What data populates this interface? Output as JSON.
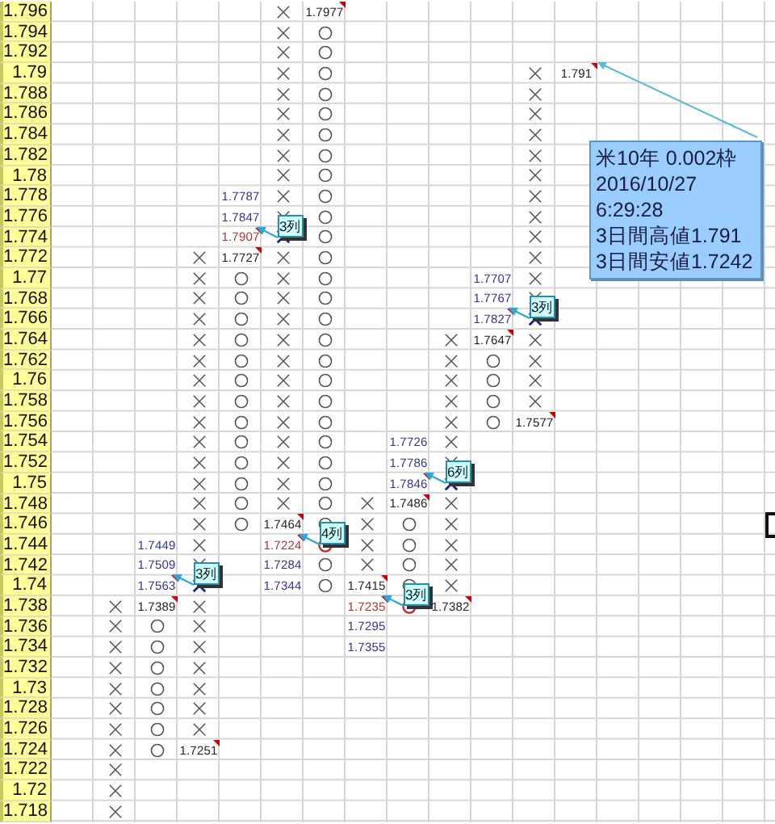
{
  "rows": [
    {
      "label": "1.796",
      "cells": [
        {
          "kind": "empty"
        },
        {
          "kind": "empty"
        },
        {
          "kind": "empty"
        },
        {
          "kind": "empty"
        },
        {
          "kind": "empty"
        },
        {
          "kind": "x",
          "highlight": false
        },
        {
          "kind": "text",
          "text": "1.7977",
          "color": "#222222",
          "comment": true
        }
      ]
    },
    {
      "label": "1.794",
      "cells": [
        {
          "kind": "empty"
        },
        {
          "kind": "empty"
        },
        {
          "kind": "empty"
        },
        {
          "kind": "empty"
        },
        {
          "kind": "empty"
        },
        {
          "kind": "x",
          "highlight": false
        },
        {
          "kind": "o",
          "highlight": false
        }
      ]
    },
    {
      "label": "1.792",
      "cells": [
        {
          "kind": "empty"
        },
        {
          "kind": "empty"
        },
        {
          "kind": "empty"
        },
        {
          "kind": "empty"
        },
        {
          "kind": "empty"
        },
        {
          "kind": "x",
          "highlight": false
        },
        {
          "kind": "o",
          "highlight": false
        }
      ]
    },
    {
      "label": "1.79",
      "cells": [
        {
          "kind": "empty"
        },
        {
          "kind": "empty"
        },
        {
          "kind": "empty"
        },
        {
          "kind": "empty"
        },
        {
          "kind": "empty"
        },
        {
          "kind": "x",
          "highlight": false
        },
        {
          "kind": "o",
          "highlight": false
        },
        {
          "kind": "empty"
        },
        {
          "kind": "empty"
        },
        {
          "kind": "empty"
        },
        {
          "kind": "empty"
        },
        {
          "kind": "x",
          "highlight": false
        },
        {
          "kind": "text",
          "text": "1.791",
          "color": "#222222",
          "comment": true,
          "note": {
            "lines": [
              "米10年 0.002枠",
              "2016/10/27",
              "6:29:28",
              "3日間高値1.791",
              "3日間安値1.7242"
            ]
          }
        }
      ]
    },
    {
      "label": "1.788",
      "cells": [
        {
          "kind": "empty"
        },
        {
          "kind": "empty"
        },
        {
          "kind": "empty"
        },
        {
          "kind": "empty"
        },
        {
          "kind": "empty"
        },
        {
          "kind": "x",
          "highlight": false
        },
        {
          "kind": "o",
          "highlight": false
        },
        {
          "kind": "empty"
        },
        {
          "kind": "empty"
        },
        {
          "kind": "empty"
        },
        {
          "kind": "empty"
        },
        {
          "kind": "x",
          "highlight": false
        }
      ]
    },
    {
      "label": "1.786",
      "cells": [
        {
          "kind": "empty"
        },
        {
          "kind": "empty"
        },
        {
          "kind": "empty"
        },
        {
          "kind": "empty"
        },
        {
          "kind": "empty"
        },
        {
          "kind": "x",
          "highlight": false
        },
        {
          "kind": "o",
          "highlight": false
        },
        {
          "kind": "empty"
        },
        {
          "kind": "empty"
        },
        {
          "kind": "empty"
        },
        {
          "kind": "empty"
        },
        {
          "kind": "x",
          "highlight": false
        }
      ]
    },
    {
      "label": "1.784",
      "cells": [
        {
          "kind": "empty"
        },
        {
          "kind": "empty"
        },
        {
          "kind": "empty"
        },
        {
          "kind": "empty"
        },
        {
          "kind": "empty"
        },
        {
          "kind": "x",
          "highlight": false
        },
        {
          "kind": "o",
          "highlight": false
        },
        {
          "kind": "empty"
        },
        {
          "kind": "empty"
        },
        {
          "kind": "empty"
        },
        {
          "kind": "empty"
        },
        {
          "kind": "x",
          "highlight": false
        }
      ]
    },
    {
      "label": "1.782",
      "cells": [
        {
          "kind": "empty"
        },
        {
          "kind": "empty"
        },
        {
          "kind": "empty"
        },
        {
          "kind": "empty"
        },
        {
          "kind": "empty"
        },
        {
          "kind": "x",
          "highlight": false
        },
        {
          "kind": "o",
          "highlight": false
        },
        {
          "kind": "empty"
        },
        {
          "kind": "empty"
        },
        {
          "kind": "empty"
        },
        {
          "kind": "empty"
        },
        {
          "kind": "x",
          "highlight": false
        }
      ]
    },
    {
      "label": "1.78",
      "cells": [
        {
          "kind": "empty"
        },
        {
          "kind": "empty"
        },
        {
          "kind": "empty"
        },
        {
          "kind": "empty"
        },
        {
          "kind": "empty"
        },
        {
          "kind": "x",
          "highlight": false
        },
        {
          "kind": "o",
          "highlight": false
        },
        {
          "kind": "empty"
        },
        {
          "kind": "empty"
        },
        {
          "kind": "empty"
        },
        {
          "kind": "empty"
        },
        {
          "kind": "x",
          "highlight": false
        }
      ]
    },
    {
      "label": "1.778",
      "cells": [
        {
          "kind": "empty"
        },
        {
          "kind": "empty"
        },
        {
          "kind": "empty"
        },
        {
          "kind": "empty"
        },
        {
          "kind": "text",
          "text": "1.7787",
          "color": "#333399",
          "comment": false
        },
        {
          "kind": "x",
          "highlight": false
        },
        {
          "kind": "o",
          "highlight": false
        },
        {
          "kind": "empty"
        },
        {
          "kind": "empty"
        },
        {
          "kind": "empty"
        },
        {
          "kind": "empty"
        },
        {
          "kind": "x",
          "highlight": false
        }
      ]
    },
    {
      "label": "1.776",
      "cells": [
        {
          "kind": "empty"
        },
        {
          "kind": "empty"
        },
        {
          "kind": "empty"
        },
        {
          "kind": "empty"
        },
        {
          "kind": "text",
          "text": "1.7847",
          "color": "#333399",
          "comment": false
        },
        {
          "kind": "x",
          "highlight": false
        },
        {
          "kind": "o",
          "highlight": false
        },
        {
          "kind": "empty"
        },
        {
          "kind": "empty"
        },
        {
          "kind": "empty"
        },
        {
          "kind": "empty"
        },
        {
          "kind": "x",
          "highlight": false
        }
      ]
    },
    {
      "label": "1.774",
      "cells": [
        {
          "kind": "empty"
        },
        {
          "kind": "empty"
        },
        {
          "kind": "empty"
        },
        {
          "kind": "empty"
        },
        {
          "kind": "text",
          "text": "1.7907",
          "color": "#aa3333",
          "comment": true,
          "callout": "3列"
        },
        {
          "kind": "x",
          "highlight": true
        },
        {
          "kind": "o",
          "highlight": false
        },
        {
          "kind": "empty"
        },
        {
          "kind": "empty"
        },
        {
          "kind": "empty"
        },
        {
          "kind": "empty"
        },
        {
          "kind": "x",
          "highlight": false
        }
      ]
    },
    {
      "label": "1.772",
      "cells": [
        {
          "kind": "empty"
        },
        {
          "kind": "empty"
        },
        {
          "kind": "empty"
        },
        {
          "kind": "x",
          "highlight": false
        },
        {
          "kind": "text",
          "text": "1.7727",
          "color": "#222222",
          "comment": true
        },
        {
          "kind": "x",
          "highlight": false
        },
        {
          "kind": "o",
          "highlight": false
        },
        {
          "kind": "empty"
        },
        {
          "kind": "empty"
        },
        {
          "kind": "empty"
        },
        {
          "kind": "empty"
        },
        {
          "kind": "x",
          "highlight": false
        }
      ]
    },
    {
      "label": "1.77",
      "cells": [
        {
          "kind": "empty"
        },
        {
          "kind": "empty"
        },
        {
          "kind": "empty"
        },
        {
          "kind": "x",
          "highlight": false
        },
        {
          "kind": "o",
          "highlight": false
        },
        {
          "kind": "x",
          "highlight": false
        },
        {
          "kind": "o",
          "highlight": false
        },
        {
          "kind": "empty"
        },
        {
          "kind": "empty"
        },
        {
          "kind": "empty"
        },
        {
          "kind": "text",
          "text": "1.7707",
          "color": "#333399",
          "comment": false
        },
        {
          "kind": "x",
          "highlight": false
        }
      ]
    },
    {
      "label": "1.768",
      "cells": [
        {
          "kind": "empty"
        },
        {
          "kind": "empty"
        },
        {
          "kind": "empty"
        },
        {
          "kind": "x",
          "highlight": false
        },
        {
          "kind": "o",
          "highlight": false
        },
        {
          "kind": "x",
          "highlight": false
        },
        {
          "kind": "o",
          "highlight": false
        },
        {
          "kind": "empty"
        },
        {
          "kind": "empty"
        },
        {
          "kind": "empty"
        },
        {
          "kind": "text",
          "text": "1.7767",
          "color": "#333399",
          "comment": false
        },
        {
          "kind": "x",
          "highlight": false
        }
      ]
    },
    {
      "label": "1.766",
      "cells": [
        {
          "kind": "empty"
        },
        {
          "kind": "empty"
        },
        {
          "kind": "empty"
        },
        {
          "kind": "x",
          "highlight": false
        },
        {
          "kind": "o",
          "highlight": false
        },
        {
          "kind": "x",
          "highlight": false
        },
        {
          "kind": "o",
          "highlight": false
        },
        {
          "kind": "empty"
        },
        {
          "kind": "empty"
        },
        {
          "kind": "empty"
        },
        {
          "kind": "text",
          "text": "1.7827",
          "color": "#333399",
          "comment": true,
          "callout": "3列"
        },
        {
          "kind": "x",
          "highlight": true
        }
      ]
    },
    {
      "label": "1.764",
      "cells": [
        {
          "kind": "empty"
        },
        {
          "kind": "empty"
        },
        {
          "kind": "empty"
        },
        {
          "kind": "x",
          "highlight": false
        },
        {
          "kind": "o",
          "highlight": false
        },
        {
          "kind": "x",
          "highlight": false
        },
        {
          "kind": "o",
          "highlight": false
        },
        {
          "kind": "empty"
        },
        {
          "kind": "empty"
        },
        {
          "kind": "x",
          "highlight": false
        },
        {
          "kind": "text",
          "text": "1.7647",
          "color": "#222222",
          "comment": true
        },
        {
          "kind": "x",
          "highlight": false
        }
      ]
    },
    {
      "label": "1.762",
      "cells": [
        {
          "kind": "empty"
        },
        {
          "kind": "empty"
        },
        {
          "kind": "empty"
        },
        {
          "kind": "x",
          "highlight": false
        },
        {
          "kind": "o",
          "highlight": false
        },
        {
          "kind": "x",
          "highlight": false
        },
        {
          "kind": "o",
          "highlight": false
        },
        {
          "kind": "empty"
        },
        {
          "kind": "empty"
        },
        {
          "kind": "x",
          "highlight": false
        },
        {
          "kind": "o",
          "highlight": false
        },
        {
          "kind": "x",
          "highlight": false
        }
      ]
    },
    {
      "label": "1.76",
      "cells": [
        {
          "kind": "empty"
        },
        {
          "kind": "empty"
        },
        {
          "kind": "empty"
        },
        {
          "kind": "x",
          "highlight": false
        },
        {
          "kind": "o",
          "highlight": false
        },
        {
          "kind": "x",
          "highlight": false
        },
        {
          "kind": "o",
          "highlight": false
        },
        {
          "kind": "empty"
        },
        {
          "kind": "empty"
        },
        {
          "kind": "x",
          "highlight": false
        },
        {
          "kind": "o",
          "highlight": false
        },
        {
          "kind": "x",
          "highlight": false
        }
      ]
    },
    {
      "label": "1.758",
      "cells": [
        {
          "kind": "empty"
        },
        {
          "kind": "empty"
        },
        {
          "kind": "empty"
        },
        {
          "kind": "x",
          "highlight": false
        },
        {
          "kind": "o",
          "highlight": false
        },
        {
          "kind": "x",
          "highlight": false
        },
        {
          "kind": "o",
          "highlight": false
        },
        {
          "kind": "empty"
        },
        {
          "kind": "empty"
        },
        {
          "kind": "x",
          "highlight": false
        },
        {
          "kind": "o",
          "highlight": false
        },
        {
          "kind": "x",
          "highlight": false
        }
      ]
    },
    {
      "label": "1.756",
      "cells": [
        {
          "kind": "empty"
        },
        {
          "kind": "empty"
        },
        {
          "kind": "empty"
        },
        {
          "kind": "x",
          "highlight": false
        },
        {
          "kind": "o",
          "highlight": false
        },
        {
          "kind": "x",
          "highlight": false
        },
        {
          "kind": "o",
          "highlight": false
        },
        {
          "kind": "empty"
        },
        {
          "kind": "empty"
        },
        {
          "kind": "x",
          "highlight": false
        },
        {
          "kind": "o",
          "highlight": false
        },
        {
          "kind": "text",
          "text": "1.7577",
          "color": "#222222",
          "comment": true
        }
      ]
    },
    {
      "label": "1.754",
      "cells": [
        {
          "kind": "empty"
        },
        {
          "kind": "empty"
        },
        {
          "kind": "empty"
        },
        {
          "kind": "x",
          "highlight": false
        },
        {
          "kind": "o",
          "highlight": false
        },
        {
          "kind": "x",
          "highlight": false
        },
        {
          "kind": "o",
          "highlight": false
        },
        {
          "kind": "empty"
        },
        {
          "kind": "text",
          "text": "1.7726",
          "color": "#333399",
          "comment": false
        },
        {
          "kind": "x",
          "highlight": false
        }
      ]
    },
    {
      "label": "1.752",
      "cells": [
        {
          "kind": "empty"
        },
        {
          "kind": "empty"
        },
        {
          "kind": "empty"
        },
        {
          "kind": "x",
          "highlight": false
        },
        {
          "kind": "o",
          "highlight": false
        },
        {
          "kind": "x",
          "highlight": false
        },
        {
          "kind": "o",
          "highlight": false
        },
        {
          "kind": "empty"
        },
        {
          "kind": "text",
          "text": "1.7786",
          "color": "#333399",
          "comment": false
        },
        {
          "kind": "x",
          "highlight": false
        }
      ]
    },
    {
      "label": "1.75",
      "cells": [
        {
          "kind": "empty"
        },
        {
          "kind": "empty"
        },
        {
          "kind": "empty"
        },
        {
          "kind": "x",
          "highlight": false
        },
        {
          "kind": "o",
          "highlight": false
        },
        {
          "kind": "x",
          "highlight": false
        },
        {
          "kind": "o",
          "highlight": false
        },
        {
          "kind": "empty"
        },
        {
          "kind": "text",
          "text": "1.7846",
          "color": "#333399",
          "comment": true,
          "callout": "6列"
        },
        {
          "kind": "x",
          "highlight": true
        }
      ]
    },
    {
      "label": "1.748",
      "cells": [
        {
          "kind": "empty"
        },
        {
          "kind": "empty"
        },
        {
          "kind": "empty"
        },
        {
          "kind": "x",
          "highlight": false
        },
        {
          "kind": "o",
          "highlight": false
        },
        {
          "kind": "x",
          "highlight": false
        },
        {
          "kind": "o",
          "highlight": false
        },
        {
          "kind": "x",
          "highlight": false
        },
        {
          "kind": "text",
          "text": "1.7486",
          "color": "#222222",
          "comment": true
        },
        {
          "kind": "x",
          "highlight": false
        }
      ]
    },
    {
      "label": "1.746",
      "cells": [
        {
          "kind": "empty"
        },
        {
          "kind": "empty"
        },
        {
          "kind": "empty"
        },
        {
          "kind": "x",
          "highlight": false
        },
        {
          "kind": "o",
          "highlight": false
        },
        {
          "kind": "text",
          "text": "1.7464",
          "color": "#222222",
          "comment": true
        },
        {
          "kind": "o",
          "highlight": false
        },
        {
          "kind": "x",
          "highlight": false
        },
        {
          "kind": "o",
          "highlight": false
        },
        {
          "kind": "x",
          "highlight": false
        },
        {
          "kind": "empty"
        },
        {
          "kind": "empty"
        },
        {
          "kind": "empty"
        },
        {
          "kind": "empty"
        },
        {
          "kind": "empty"
        },
        {
          "kind": "empty"
        },
        {
          "kind": "empty"
        },
        {
          "kind": "cursor"
        }
      ]
    },
    {
      "label": "1.744",
      "cells": [
        {
          "kind": "empty"
        },
        {
          "kind": "empty"
        },
        {
          "kind": "text",
          "text": "1.7449",
          "color": "#333399",
          "comment": false
        },
        {
          "kind": "x",
          "highlight": false
        },
        {
          "kind": "empty"
        },
        {
          "kind": "text",
          "text": "1.7224",
          "color": "#aa3333",
          "comment": true,
          "callout": "4列"
        },
        {
          "kind": "o",
          "highlight": true
        },
        {
          "kind": "x",
          "highlight": false
        },
        {
          "kind": "o",
          "highlight": false
        },
        {
          "kind": "x",
          "highlight": false
        }
      ]
    },
    {
      "label": "1.742",
      "cells": [
        {
          "kind": "empty"
        },
        {
          "kind": "empty"
        },
        {
          "kind": "text",
          "text": "1.7509",
          "color": "#333399",
          "comment": false
        },
        {
          "kind": "x",
          "highlight": false
        },
        {
          "kind": "empty"
        },
        {
          "kind": "text",
          "text": "1.7284",
          "color": "#333399",
          "comment": false
        },
        {
          "kind": "o",
          "highlight": false
        },
        {
          "kind": "x",
          "highlight": false
        },
        {
          "kind": "o",
          "highlight": false
        },
        {
          "kind": "x",
          "highlight": false
        }
      ]
    },
    {
      "label": "1.74",
      "cells": [
        {
          "kind": "empty"
        },
        {
          "kind": "empty"
        },
        {
          "kind": "text",
          "text": "1.7563",
          "color": "#333399",
          "comment": true,
          "callout": "3列"
        },
        {
          "kind": "x",
          "highlight": true
        },
        {
          "kind": "empty"
        },
        {
          "kind": "text",
          "text": "1.7344",
          "color": "#333399",
          "comment": false
        },
        {
          "kind": "o",
          "highlight": false
        },
        {
          "kind": "text",
          "text": "1.7415",
          "color": "#222222",
          "comment": true
        },
        {
          "kind": "o",
          "highlight": false
        },
        {
          "kind": "x",
          "highlight": false
        }
      ]
    },
    {
      "label": "1.738",
      "cells": [
        {
          "kind": "empty"
        },
        {
          "kind": "x",
          "highlight": false
        },
        {
          "kind": "text",
          "text": "1.7389",
          "color": "#222222",
          "comment": true
        },
        {
          "kind": "x",
          "highlight": false
        },
        {
          "kind": "empty"
        },
        {
          "kind": "empty"
        },
        {
          "kind": "empty"
        },
        {
          "kind": "text",
          "text": "1.7235",
          "color": "#aa3333",
          "comment": true,
          "callout": "3列"
        },
        {
          "kind": "o",
          "highlight": true
        },
        {
          "kind": "text",
          "text": "1.7382",
          "color": "#222222",
          "comment": true
        }
      ]
    },
    {
      "label": "1.736",
      "cells": [
        {
          "kind": "empty"
        },
        {
          "kind": "x",
          "highlight": false
        },
        {
          "kind": "o",
          "highlight": false
        },
        {
          "kind": "x",
          "highlight": false
        },
        {
          "kind": "empty"
        },
        {
          "kind": "empty"
        },
        {
          "kind": "empty"
        },
        {
          "kind": "text",
          "text": "1.7295",
          "color": "#333399",
          "comment": false
        }
      ]
    },
    {
      "label": "1.734",
      "cells": [
        {
          "kind": "empty"
        },
        {
          "kind": "x",
          "highlight": false
        },
        {
          "kind": "o",
          "highlight": false
        },
        {
          "kind": "x",
          "highlight": false
        },
        {
          "kind": "empty"
        },
        {
          "kind": "empty"
        },
        {
          "kind": "empty"
        },
        {
          "kind": "text",
          "text": "1.7355",
          "color": "#333399",
          "comment": false
        }
      ]
    },
    {
      "label": "1.732",
      "cells": [
        {
          "kind": "empty"
        },
        {
          "kind": "x",
          "highlight": false
        },
        {
          "kind": "o",
          "highlight": false
        },
        {
          "kind": "x",
          "highlight": false
        }
      ]
    },
    {
      "label": "1.73",
      "cells": [
        {
          "kind": "empty"
        },
        {
          "kind": "x",
          "highlight": false
        },
        {
          "kind": "o",
          "highlight": false
        },
        {
          "kind": "x",
          "highlight": false
        }
      ]
    },
    {
      "label": "1.728",
      "cells": [
        {
          "kind": "empty"
        },
        {
          "kind": "x",
          "highlight": false
        },
        {
          "kind": "o",
          "highlight": false
        },
        {
          "kind": "x",
          "highlight": false
        }
      ]
    },
    {
      "label": "1.726",
      "cells": [
        {
          "kind": "empty"
        },
        {
          "kind": "x",
          "highlight": false
        },
        {
          "kind": "o",
          "highlight": false
        },
        {
          "kind": "x",
          "highlight": false
        }
      ]
    },
    {
      "label": "1.724",
      "cells": [
        {
          "kind": "empty"
        },
        {
          "kind": "x",
          "highlight": false
        },
        {
          "kind": "o",
          "highlight": false
        },
        {
          "kind": "text",
          "text": "1.7251",
          "color": "#222222",
          "comment": true
        }
      ]
    },
    {
      "label": "1.722",
      "cells": [
        {
          "kind": "empty"
        },
        {
          "kind": "x",
          "highlight": false
        }
      ]
    },
    {
      "label": "1.72",
      "cells": [
        {
          "kind": "empty"
        },
        {
          "kind": "x",
          "highlight": false
        }
      ]
    },
    {
      "label": "1.718",
      "cells": [
        {
          "kind": "empty"
        },
        {
          "kind": "x",
          "highlight": false
        }
      ]
    }
  ]
}
